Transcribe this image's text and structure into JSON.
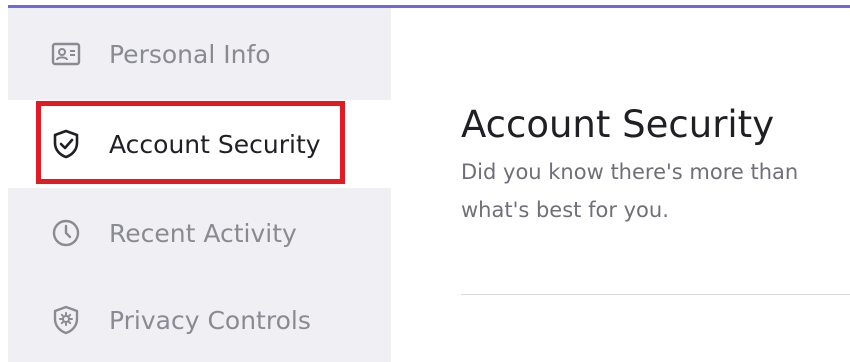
{
  "sidebar": {
    "items": [
      {
        "label": "Personal Info",
        "icon": "id-card-icon"
      },
      {
        "label": "Account Security",
        "icon": "shield-check-icon",
        "active": true
      },
      {
        "label": "Recent Activity",
        "icon": "clock-icon"
      },
      {
        "label": "Privacy Controls",
        "icon": "shield-gear-icon"
      }
    ]
  },
  "main": {
    "title": "Account Security",
    "description_line1": "Did you know there's more than",
    "description_line2": "what's best for you."
  },
  "colors": {
    "accent": "#6f6ad9",
    "highlight": "#e01b22",
    "sidebar_bg": "#f0f0f4"
  }
}
